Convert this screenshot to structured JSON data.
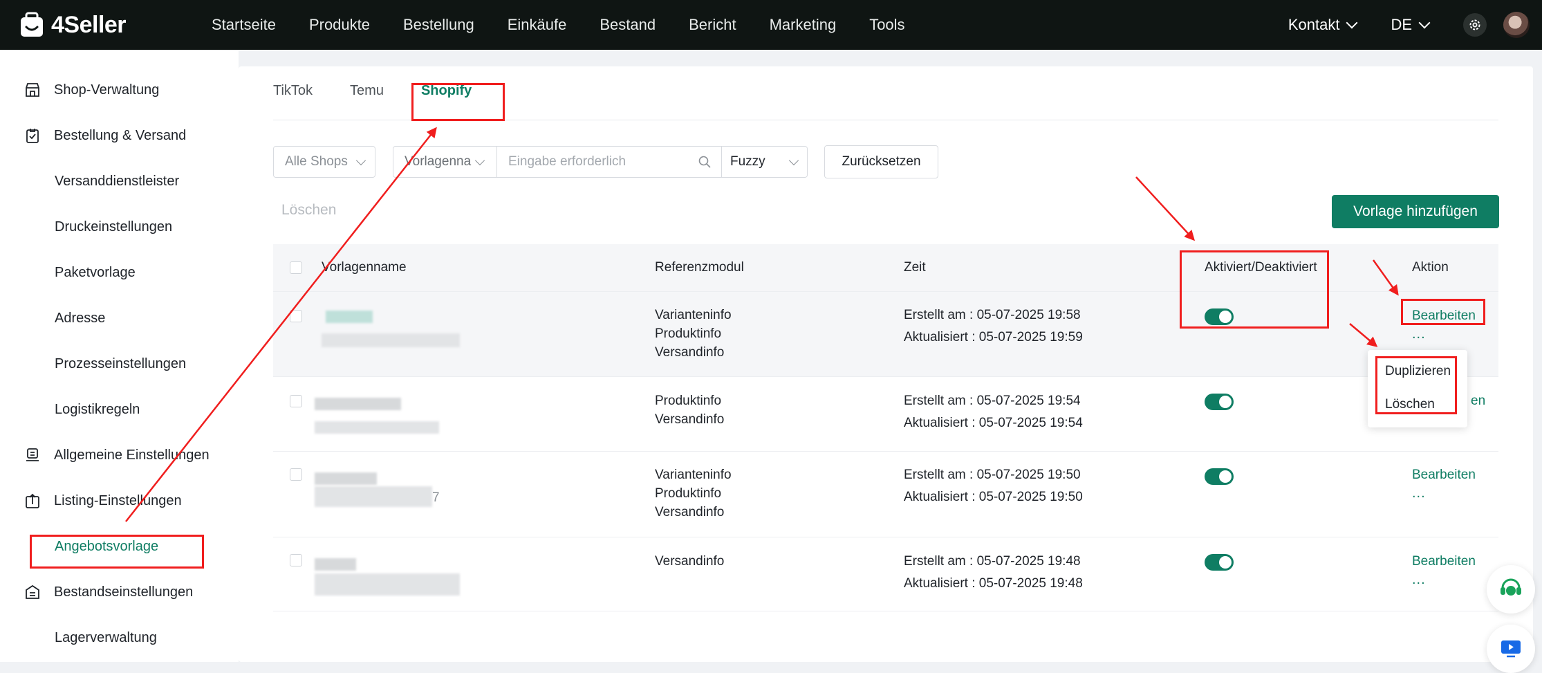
{
  "app": {
    "name": "4Seller"
  },
  "topnav": {
    "items": [
      "Startseite",
      "Produkte",
      "Bestellung",
      "Einkäufe",
      "Bestand",
      "Bericht",
      "Marketing",
      "Tools"
    ],
    "contact": "Kontakt",
    "language": "DE"
  },
  "sidebar": {
    "items": [
      {
        "label": "Shop-Verwaltung",
        "icon": "shop-icon"
      },
      {
        "label": "Bestellung & Versand",
        "icon": "order-icon"
      },
      {
        "label": "Versanddienstleister"
      },
      {
        "label": "Druckeinstellungen"
      },
      {
        "label": "Paketvorlage"
      },
      {
        "label": "Adresse"
      },
      {
        "label": "Prozesseinstellungen"
      },
      {
        "label": "Logistikregeln"
      },
      {
        "label": "Allgemeine Einstellungen",
        "icon": "general-settings-icon"
      },
      {
        "label": "Listing-Einstellungen",
        "icon": "listing-upload-icon"
      },
      {
        "label": "Angebotsvorlage",
        "active": true
      },
      {
        "label": "Bestandseinstellungen",
        "icon": "inventory-icon"
      },
      {
        "label": "Lagerverwaltung"
      }
    ]
  },
  "tabs": [
    {
      "label": "TikTok"
    },
    {
      "label": "Temu"
    },
    {
      "label": "Shopify",
      "active": true
    }
  ],
  "filters": {
    "shops": "Alle Shops",
    "field_select": "Vorlagenna",
    "search_placeholder": "Eingabe erforderlich",
    "match_mode": "Fuzzy",
    "reset": "Zurücksetzen"
  },
  "actions": {
    "delete": "Löschen",
    "add": "Vorlage hinzufügen"
  },
  "table": {
    "columns": {
      "name": "Vorlagenname",
      "modules": "Referenzmodul",
      "time": "Zeit",
      "status": "Aktiviert/Deaktiviert",
      "action": "Aktion"
    },
    "rows": [
      {
        "modules": [
          "Varianteninfo",
          "Produktinfo",
          "Versandinfo"
        ],
        "created": "Erstellt am : 05-07-2025 19:58",
        "updated": "Aktualisiert : 05-07-2025 19:59",
        "enabled": true,
        "edit": "Bearbeiten",
        "more": "..."
      },
      {
        "modules": [
          "Produktinfo",
          "Versandinfo"
        ],
        "created": "Erstellt am : 05-07-2025 19:54",
        "updated": "Aktualisiert : 05-07-2025 19:54",
        "enabled": true,
        "edit": "Bearbeiten",
        "more": "..."
      },
      {
        "modules": [
          "Varianteninfo",
          "Produktinfo",
          "Versandinfo"
        ],
        "created": "Erstellt am : 05-07-2025 19:50",
        "updated": "Aktualisiert : 05-07-2025 19:50",
        "enabled": true,
        "edit": "Bearbeiten",
        "more": "..."
      },
      {
        "modules": [
          "Versandinfo"
        ],
        "created": "Erstellt am : 05-07-2025 19:48",
        "updated": "Aktualisiert : 05-07-2025 19:48",
        "enabled": true,
        "edit": "Bearbeiten",
        "more": "..."
      }
    ],
    "row_name_fragment": "7",
    "behind_menu_text": "en"
  },
  "dropdown": {
    "items": [
      "Duplizieren",
      "Löschen"
    ]
  },
  "colors": {
    "brand": "#0f7d63",
    "topbar": "#0f1513",
    "annotation": "#f01e1e"
  }
}
